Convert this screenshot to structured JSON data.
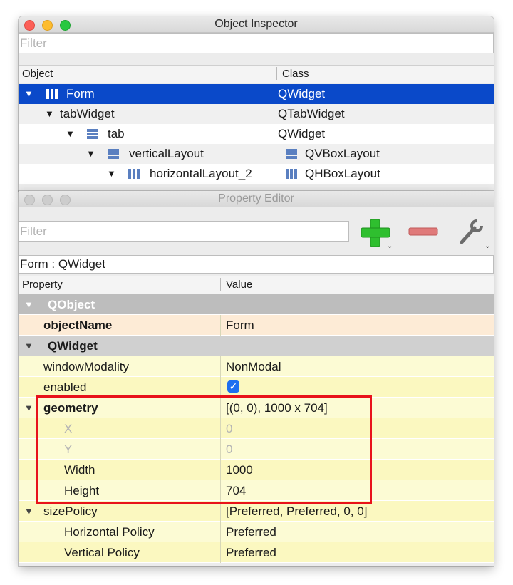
{
  "object_inspector": {
    "title": "Object Inspector",
    "filter_placeholder": "Filter",
    "columns": {
      "object": "Object",
      "class": "Class"
    },
    "rows": [
      {
        "name": "Form",
        "class": "QWidget"
      },
      {
        "name": "tabWidget",
        "class": "QTabWidget"
      },
      {
        "name": "tab",
        "class": "QWidget"
      },
      {
        "name": "verticalLayout",
        "class": "QVBoxLayout"
      },
      {
        "name": "horizontalLayout_2",
        "class": "QHBoxLayout"
      }
    ]
  },
  "property_editor": {
    "title": "Property Editor",
    "filter_placeholder": "Filter",
    "object_label": "Form : QWidget",
    "columns": {
      "property": "Property",
      "value": "Value"
    },
    "groups": {
      "qobject": "QObject",
      "qwidget": "QWidget"
    },
    "properties": {
      "objectName": {
        "name": "objectName",
        "value": "Form"
      },
      "windowModality": {
        "name": "windowModality",
        "value": "NonModal"
      },
      "enabled": {
        "name": "enabled",
        "checked": true
      },
      "geometry": {
        "name": "geometry",
        "value": "[(0, 0), 1000 x 704]"
      },
      "x": {
        "name": "X",
        "value": "0"
      },
      "y": {
        "name": "Y",
        "value": "0"
      },
      "width": {
        "name": "Width",
        "value": "1000"
      },
      "height": {
        "name": "Height",
        "value": "704"
      },
      "sizePolicy": {
        "name": "sizePolicy",
        "value": "[Preferred, Preferred, 0, 0]"
      },
      "hpolicy": {
        "name": "Horizontal Policy",
        "value": "Preferred"
      },
      "vpolicy": {
        "name": "Vertical Policy",
        "value": "Preferred"
      }
    }
  },
  "colors": {
    "selection": "#0a49c9",
    "highlight_box": "#e8121b",
    "add_icon": "#2fbf2f",
    "remove_icon": "#e07a7a"
  },
  "icons": [
    "hbox-layout-icon",
    "vbox-layout-icon",
    "add-icon",
    "remove-icon",
    "wrench-icon",
    "checkmark-icon"
  ]
}
